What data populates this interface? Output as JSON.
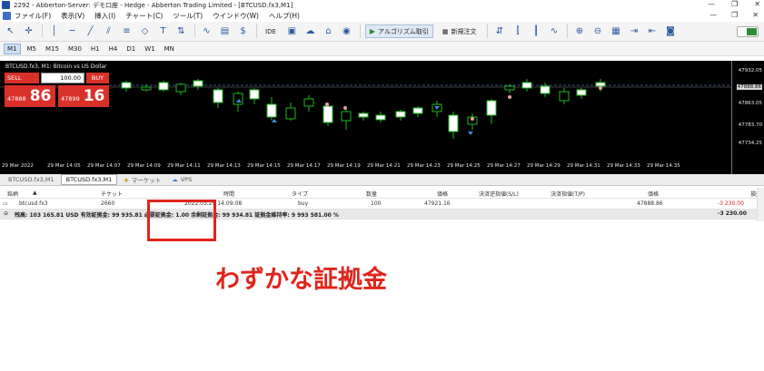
{
  "titlebar": {
    "text": "2292 - Abberton-Server: デモ口座 - Hedge - Abberton Trading Limited - [BTCUSD.fx3,M1]"
  },
  "menu": {
    "items": [
      "ファイル(F)",
      "表示(V)",
      "挿入(I)",
      "チャート(C)",
      "ツール(T)",
      "ウインドウ(W)",
      "ヘルプ(H)"
    ]
  },
  "toolbar": {
    "ide": "IDE",
    "algo_label": "アルゴリズム取引",
    "new_order_label": "新規注文"
  },
  "timeframes": {
    "items": [
      "M1",
      "M5",
      "M15",
      "M30",
      "H1",
      "H4",
      "D1",
      "W1",
      "MN"
    ],
    "active": "M1"
  },
  "chart": {
    "title": "BTCUSD.fx3, M1: Bitcoin vs US Dollar",
    "trade_panel": {
      "sell_label": "SELL",
      "buy_label": "BUY",
      "lot": "100.00",
      "sell_small": "47888",
      "sell_big": "86",
      "buy_small": "47899",
      "buy_big": "16"
    },
    "y_labels": [
      "47932.05",
      "47888.86",
      "47863.05",
      "47783.70",
      "47734.25"
    ],
    "x_labels": [
      "29 Mar 2022",
      "29 Mar 14:05",
      "29 Mar 14:07",
      "29 Mar 14:09",
      "29 Mar 14:11",
      "29 Mar 14:13",
      "29 Mar 14:15",
      "29 Mar 14:17",
      "29 Mar 14:19",
      "29 Mar 14:21",
      "29 Mar 14:23",
      "29 Mar 14:25",
      "29 Mar 14:27",
      "29 Mar 14:29",
      "29 Mar 14:31",
      "29 Mar 14:33",
      "29 Mar 14:35"
    ]
  },
  "chart_tabs": {
    "items": [
      "BTCUSD.fx3,M1",
      "BTCUSD.fx3,M1",
      "マーケット",
      "VPS"
    ]
  },
  "trade_table": {
    "headers": [
      "銘柄",
      "チケット",
      "時間",
      "タイプ",
      "数量",
      "価格",
      "決済逆指値(S/L)",
      "決済指値(T/P)",
      "価格",
      "損益"
    ],
    "row": {
      "symbol": "btcusd.fx3",
      "ticket": "2660",
      "time": "2022.03.29 14:09:08",
      "type": "buy",
      "volume": "100",
      "price": "47921.16",
      "sl": "",
      "tp": "",
      "current_price": "47888.86",
      "profit": "-3 230.00"
    },
    "summary": {
      "text": "残高: 103 165.81 USD  有効証拠金: 99 935.81  必要証拠金: 1.00  余剰証拠金: 99 934.81  証拠金維持率: 9 993 581.00 %",
      "total": "-3 230.00"
    }
  },
  "annotation": {
    "text": "わずかな証拠金",
    "color": "#e0241b"
  }
}
